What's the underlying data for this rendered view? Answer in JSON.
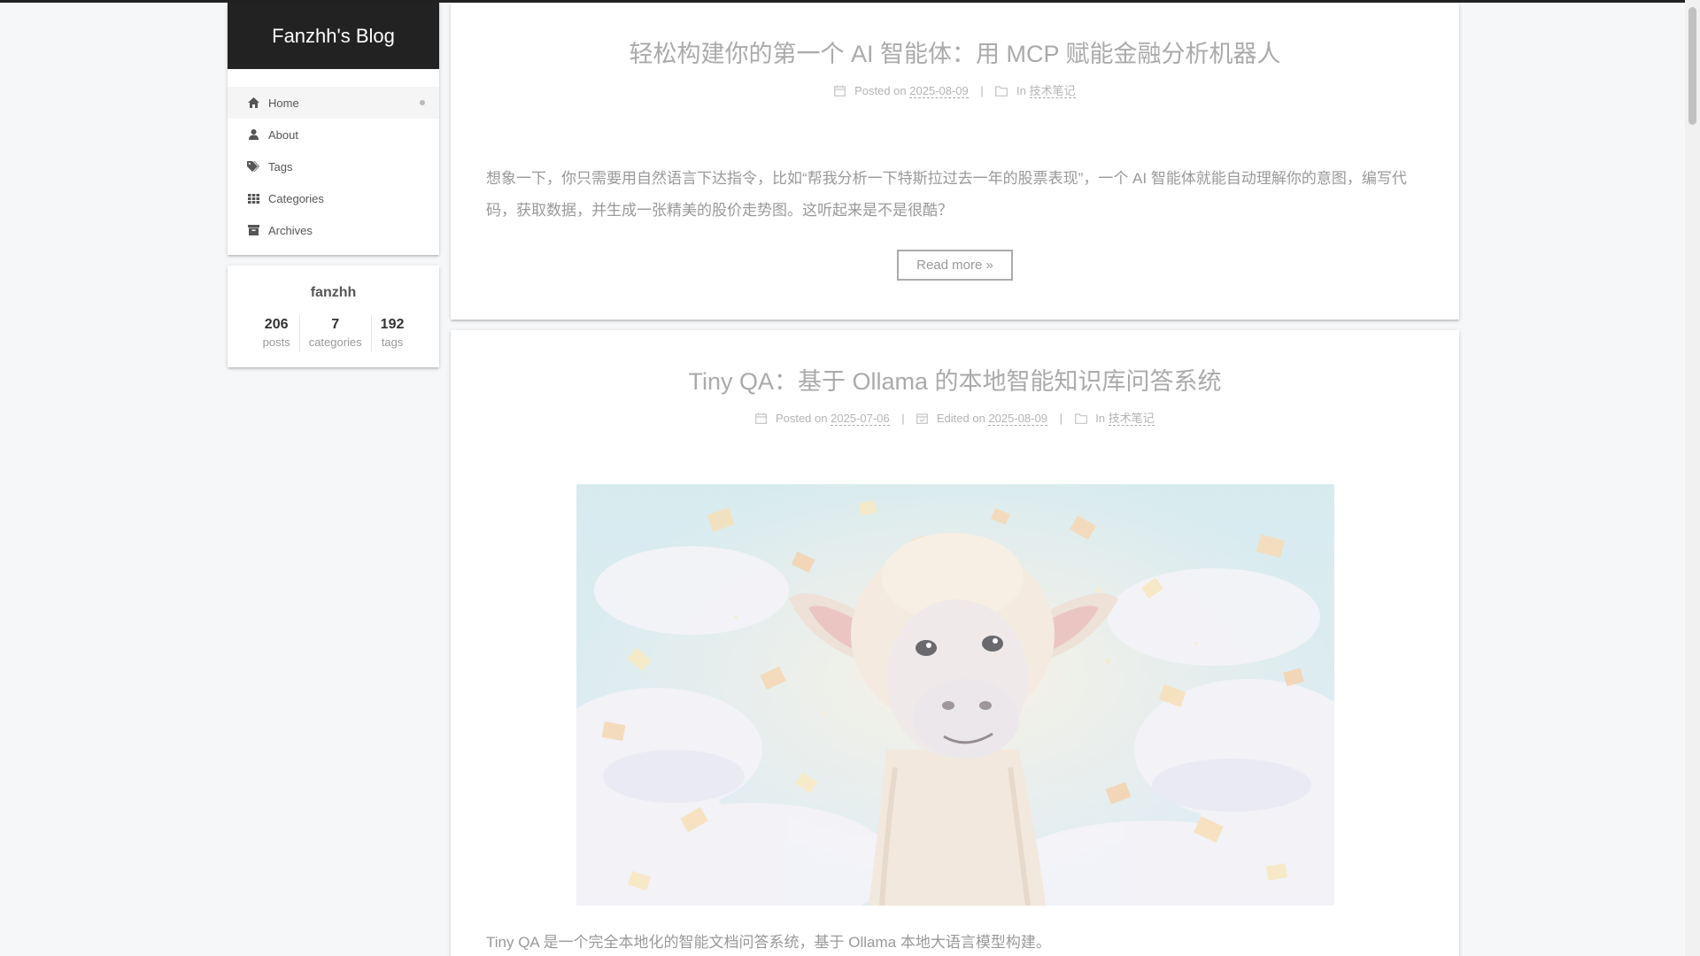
{
  "site": {
    "title": "Fanzhh's Blog"
  },
  "nav": {
    "items": [
      {
        "label": "Home",
        "icon": "home-icon"
      },
      {
        "label": "About",
        "icon": "user-icon"
      },
      {
        "label": "Tags",
        "icon": "tags-icon"
      },
      {
        "label": "Categories",
        "icon": "grid-icon"
      },
      {
        "label": "Archives",
        "icon": "archive-icon"
      }
    ]
  },
  "author": {
    "name": "fanzhh",
    "stats": [
      {
        "count": "206",
        "label": "posts"
      },
      {
        "count": "7",
        "label": "categories"
      },
      {
        "count": "192",
        "label": "tags"
      }
    ]
  },
  "posts": [
    {
      "title": "轻松构建你的第一个 AI 智能体：用 MCP 赋能金融分析机器人",
      "posted_label": "Posted on",
      "posted_date": "2025-08-09",
      "in_label": "In",
      "category": "技术笔记",
      "excerpt": "想象一下，你只需要用自然语言下达指令，比如“帮我分析一下特斯拉过去一年的股票表现”，一个 AI 智能体就能自动理解你的意图，编写代码，获取数据，并生成一张精美的股价走势图。这听起来是不是很酷？",
      "read_more": "Read more »"
    },
    {
      "title": "Tiny QA：基于 Ollama 的本地智能知识库问答系统",
      "posted_label": "Posted on",
      "posted_date": "2025-07-06",
      "edited_label": "Edited on",
      "edited_date": "2025-08-09",
      "in_label": "In",
      "category": "技术笔记",
      "excerpt": "Tiny QA 是一个完全本地化的智能文档问答系统，基于 Ollama 本地大语言模型构建。"
    }
  ]
}
